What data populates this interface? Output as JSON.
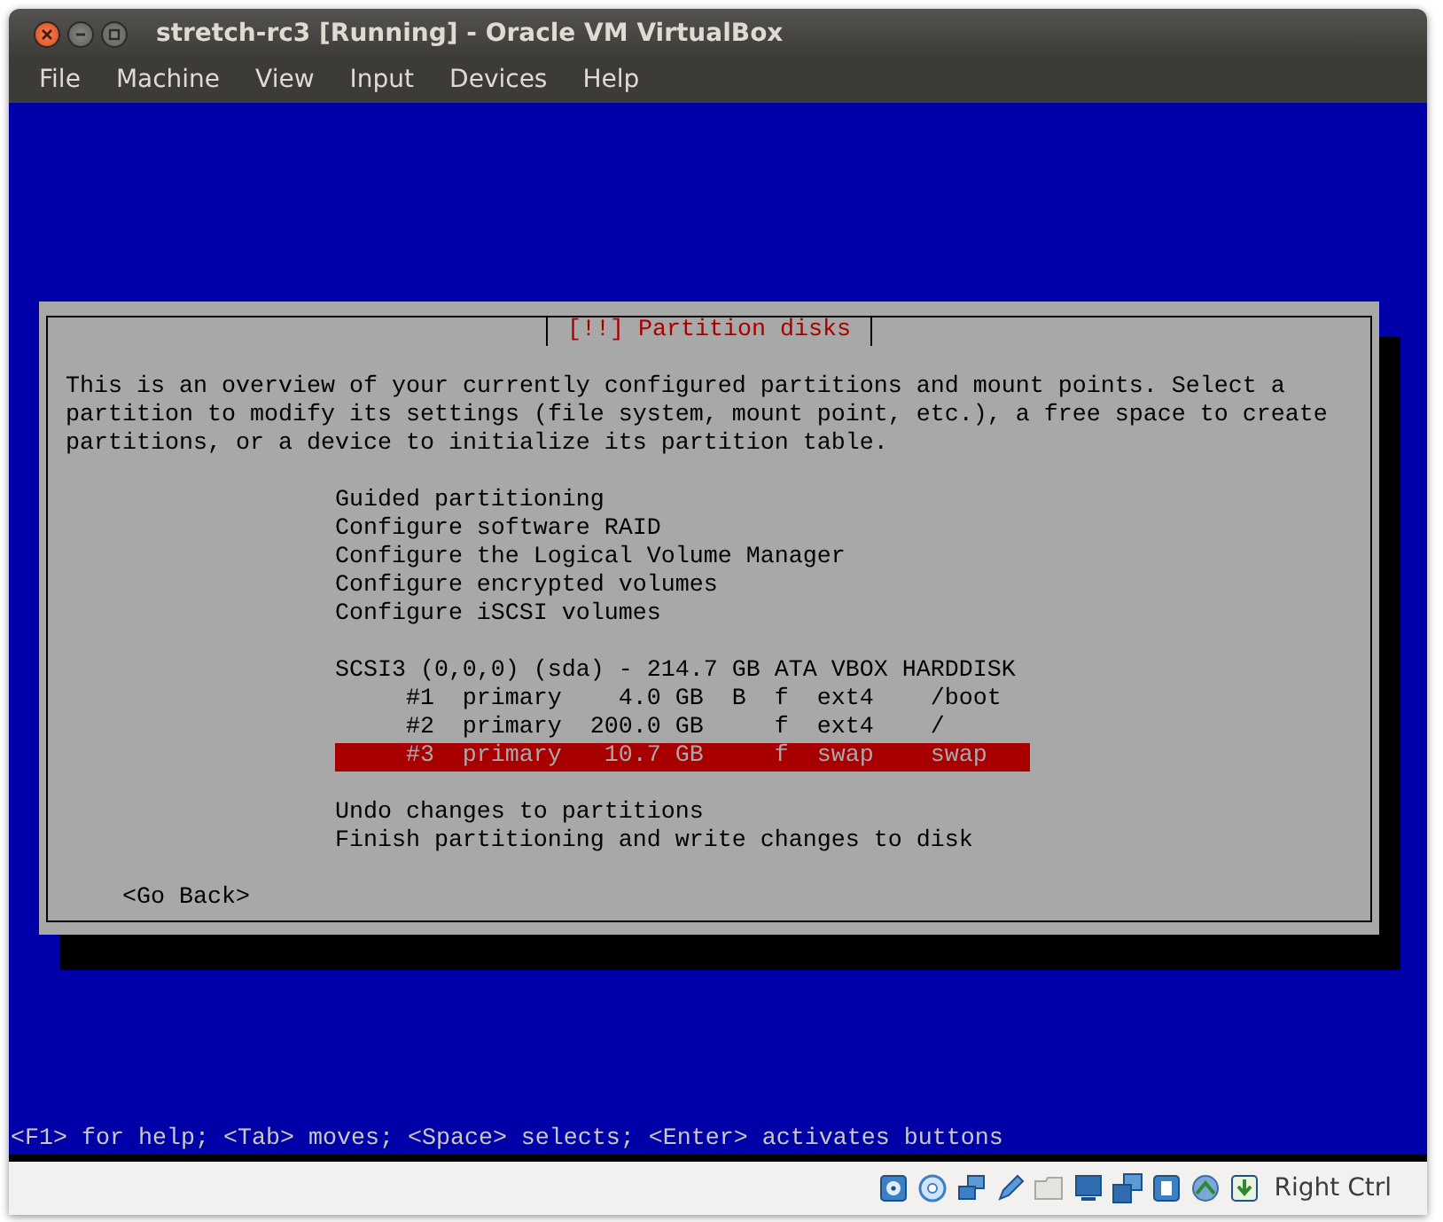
{
  "window": {
    "title": "stretch-rc3 [Running] - Oracle VM VirtualBox"
  },
  "menu": [
    "File",
    "Machine",
    "View",
    "Input",
    "Devices",
    "Help"
  ],
  "dialog": {
    "title": "[!!] Partition disks",
    "description": "This is an overview of your currently configured partitions and mount points. Select a partition to modify its settings (file system, mount point, etc.), a free space to create partitions, or a device to initialize its partition table.",
    "groups": [
      [
        {
          "kind": "action",
          "text": "Guided partitioning",
          "selected": false
        },
        {
          "kind": "action",
          "text": "Configure software RAID",
          "selected": false
        },
        {
          "kind": "action",
          "text": "Configure the Logical Volume Manager",
          "selected": false
        },
        {
          "kind": "action",
          "text": "Configure encrypted volumes",
          "selected": false
        },
        {
          "kind": "action",
          "text": "Configure iSCSI volumes",
          "selected": false
        }
      ],
      [
        {
          "kind": "device",
          "text": "SCSI3 (0,0,0) (sda) - 214.7 GB ATA VBOX HARDDISK",
          "selected": false
        },
        {
          "kind": "partition",
          "number": "#1",
          "type": "primary",
          "size": "4.0 GB",
          "bootable": "B",
          "format": "f",
          "filesystem": "ext4",
          "mount": "/boot",
          "selected": false
        },
        {
          "kind": "partition",
          "number": "#2",
          "type": "primary",
          "size": "200.0 GB",
          "format": "f",
          "filesystem": "ext4",
          "mount": "/",
          "selected": false
        },
        {
          "kind": "partition",
          "number": "#3",
          "type": "primary",
          "size": "10.7 GB",
          "format": "f",
          "filesystem": "swap",
          "mount": "swap",
          "selected": true
        }
      ],
      [
        {
          "kind": "action",
          "text": "Undo changes to partitions",
          "selected": false
        },
        {
          "kind": "action",
          "text": "Finish partitioning and write changes to disk",
          "selected": false
        }
      ]
    ],
    "back_button": "<Go Back>"
  },
  "help_line": "<F1> for help; <Tab> moves; <Space> selects; <Enter> activates buttons",
  "status_bar": {
    "host_key": "Right Ctrl"
  }
}
